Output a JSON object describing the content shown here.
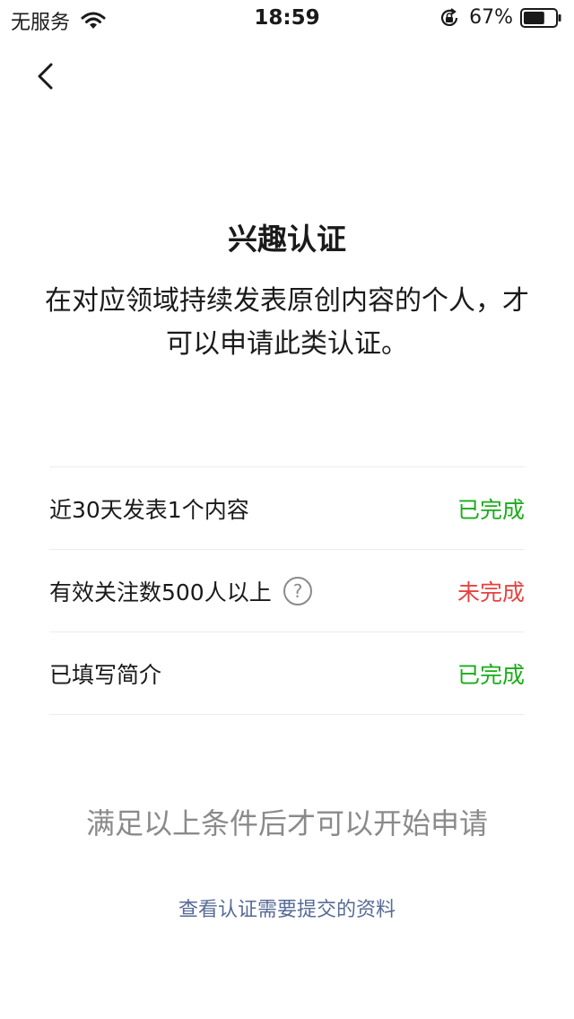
{
  "status_bar": {
    "carrier": "无服务",
    "time": "18:59",
    "battery": "67%",
    "icons": [
      "wifi-icon",
      "rotation-lock-icon",
      "battery-icon"
    ],
    "battery_level": 0.67
  },
  "header": {
    "back_icon": "chevron-left-icon"
  },
  "page": {
    "title": "兴趣认证",
    "description": "在对应领域持续发表原创内容的个人，才可以申请此类认证。"
  },
  "requirements": [
    {
      "label": "近30天发表1个内容",
      "status": "已完成",
      "done": true
    },
    {
      "label": "有效关注数500人以上",
      "status": "未完成",
      "done": false,
      "help_icon": "question-circle-icon"
    },
    {
      "label": "已填写简介",
      "status": "已完成",
      "done": true
    }
  ],
  "footer": {
    "hint": "满足以上条件后才可以开始申请",
    "link": "查看认证需要提交的资料"
  },
  "colors": {
    "done": "#1aad19",
    "todo": "#e64340",
    "link": "#576b95",
    "hint": "#8a8a8a"
  }
}
